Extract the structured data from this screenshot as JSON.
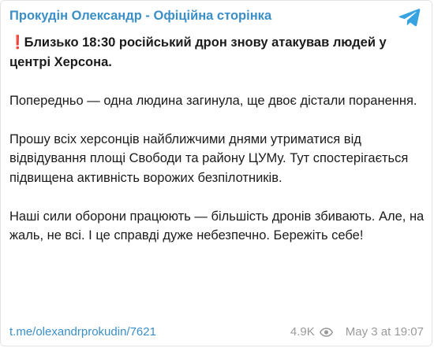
{
  "channel": {
    "name": "Прокудін Олександр - Офіційна сторінка"
  },
  "post": {
    "headline_emoji": "❗",
    "headline": "Близько 18:30 російський дрон знову атакував людей у центрі Херсона.",
    "paragraphs": [
      "Попередньо — одна людина загинула, ще двоє дістали поранення.",
      "Прошу всіх херсонців найближчими днями утриматися від відвідування площі Свободи та району ЦУМу. Тут спостерігається підвищена активність ворожих безпілотників.",
      "Наші сили оборони працюють — більшість дронів збивають. Але, на жаль, не всі. І це справді дуже небезпечно. Бережіть себе!"
    ]
  },
  "footer": {
    "link": "t.me/olexandrprokudin/7621",
    "views": "4.9K",
    "date": "May 3 at 19:07"
  },
  "icons": {
    "telegram": "telegram-logo-icon",
    "views": "eye-icon"
  },
  "colors": {
    "accent": "#3a8fc8",
    "text": "#1b1b1b",
    "muted": "#9a9a9a",
    "alert": "#e0241b"
  }
}
